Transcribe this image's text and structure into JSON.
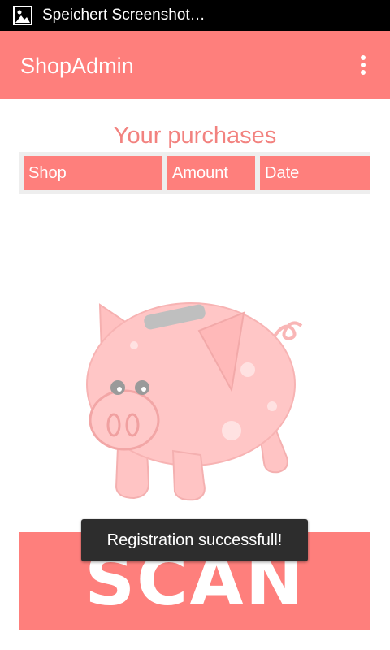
{
  "status_bar": {
    "notification_icon": "image-icon",
    "text": "Speichert Screenshot…"
  },
  "action_bar": {
    "title": "ShopAdmin",
    "overflow_icon": "overflow-menu-icon"
  },
  "main": {
    "title": "Your purchases",
    "table": {
      "columns": [
        "Shop",
        "Amount",
        "Date"
      ],
      "rows": []
    },
    "illustration": "piggy-bank-icon",
    "scan_label": "SCAN"
  },
  "toast": {
    "message": "Registration successfull!"
  },
  "colors": {
    "primary": "#fe7f7c",
    "title_text": "#f2827f",
    "table_bg": "#eeeeee",
    "toast_bg": "#2d2d2d"
  }
}
